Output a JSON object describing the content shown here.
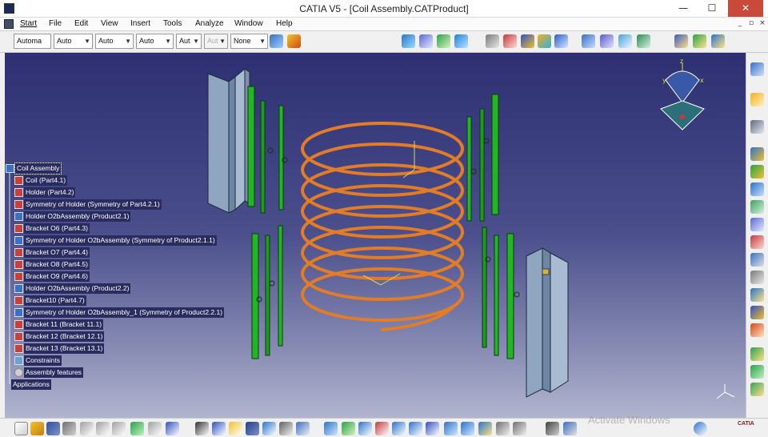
{
  "window": {
    "title": "CATIA V5 - [Coil Assembly.CATProduct]",
    "minimize": "—",
    "maximize": "☐",
    "close": "✕",
    "doc_minimize": "_",
    "doc_restore": "▫",
    "doc_close": "×"
  },
  "menu": [
    "Start",
    "File",
    "Edit",
    "View",
    "Insert",
    "Tools",
    "Analyze",
    "Window",
    "Help"
  ],
  "toolbar": {
    "combos": [
      "Automa",
      "Auto",
      "Auto",
      "Auto",
      "Aut",
      "Aut",
      "None"
    ],
    "icons": [
      "paint-brush-icon",
      "format-painter-icon",
      "snap-icon",
      "explode-icon",
      "manipulate-icon",
      "stop-manipulate-icon",
      "bill-of-material-icon",
      "update-icon",
      "fix-component-icon",
      "coincidence-constraint-icon",
      "contact-constraint-icon",
      "offset-constraint-icon",
      "angle-constraint-icon",
      "fix-together-icon",
      "quick-constraint-icon",
      "product-icon",
      "new-part-icon",
      "existing-component-icon"
    ]
  },
  "tree": {
    "root": "Coil Assembly",
    "items": [
      "Coil (Part4.1)",
      "Holder (Part4.2)",
      "Symmetry of Holder (Symmetry of Part4.2.1)",
      "Holder O2bAssembly (Product2.1)",
      "Bracket O6 (Part4.3)",
      "Symmetry of Holder O2bAssembly (Symmetry of Product2.1.1)",
      "Bracket O7 (Part4.4)",
      "Bracket O8 (Part4.5)",
      "Bracket O9 (Part4.6)",
      "Holder O2bAssembly (Product2.2)",
      "Bracket10 (Part4.7)",
      "Symmetry of Holder O2bAssembly_1 (Symmetry of Product2.2.1)",
      "Bracket 11 (Bracket 11.1)",
      "Bracket 12 (Bracket 12.1)",
      "Bracket 13 (Bracket 13.1)",
      "Constraints",
      "Assembly features"
    ],
    "applications": "Applications"
  },
  "compass": {
    "z": "z",
    "x": "x",
    "y": "y"
  },
  "colors": {
    "coil": "#e27c27",
    "bracket": "#22b522",
    "holder": "#8aa0b8",
    "background_top": "#2d2f72",
    "background_bottom": "#b2b5cf"
  },
  "watermark": "Activate Windows",
  "brand": "CATIA"
}
